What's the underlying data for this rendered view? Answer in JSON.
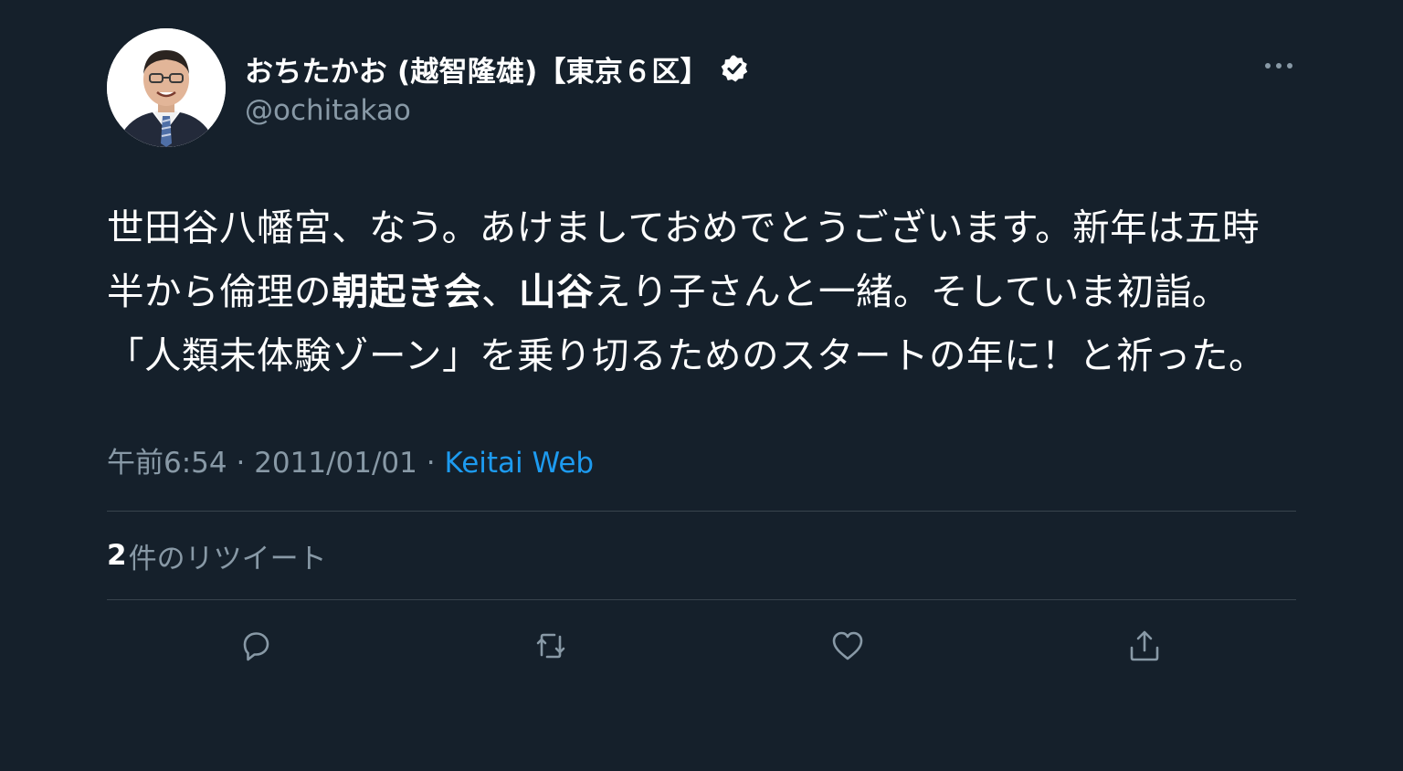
{
  "author": {
    "display_name": "おちたかお (越智隆雄)【東京６区】",
    "handle": "@ochitakao",
    "verified": true
  },
  "tweet": {
    "segments": [
      {
        "text": "世田谷八幡宮、なう。あけましておめでとうございます。新年は五時半から倫理の",
        "bold": false
      },
      {
        "text": "朝起き会",
        "bold": true
      },
      {
        "text": "、",
        "bold": false
      },
      {
        "text": "山谷",
        "bold": true
      },
      {
        "text": "えり子さんと一緒。そしていま初詣。「人類未体験ゾーン」を乗り切るためのスタートの年に！と祈った。",
        "bold": false
      }
    ]
  },
  "meta": {
    "time": "午前6:54",
    "separator": " · ",
    "date": "2011/01/01",
    "source": "Keitai Web"
  },
  "stats": {
    "retweet_count": "2",
    "retweet_label": "件のリツイート"
  },
  "icons": {
    "more": "more-horizontal-icon",
    "reply": "reply-icon",
    "retweet": "retweet-icon",
    "like": "heart-icon",
    "share": "share-icon"
  },
  "colors": {
    "background": "#15202b",
    "text_primary": "#ffffff",
    "text_secondary": "#8899a6",
    "accent": "#1d9bf0",
    "divider": "#38444d"
  }
}
